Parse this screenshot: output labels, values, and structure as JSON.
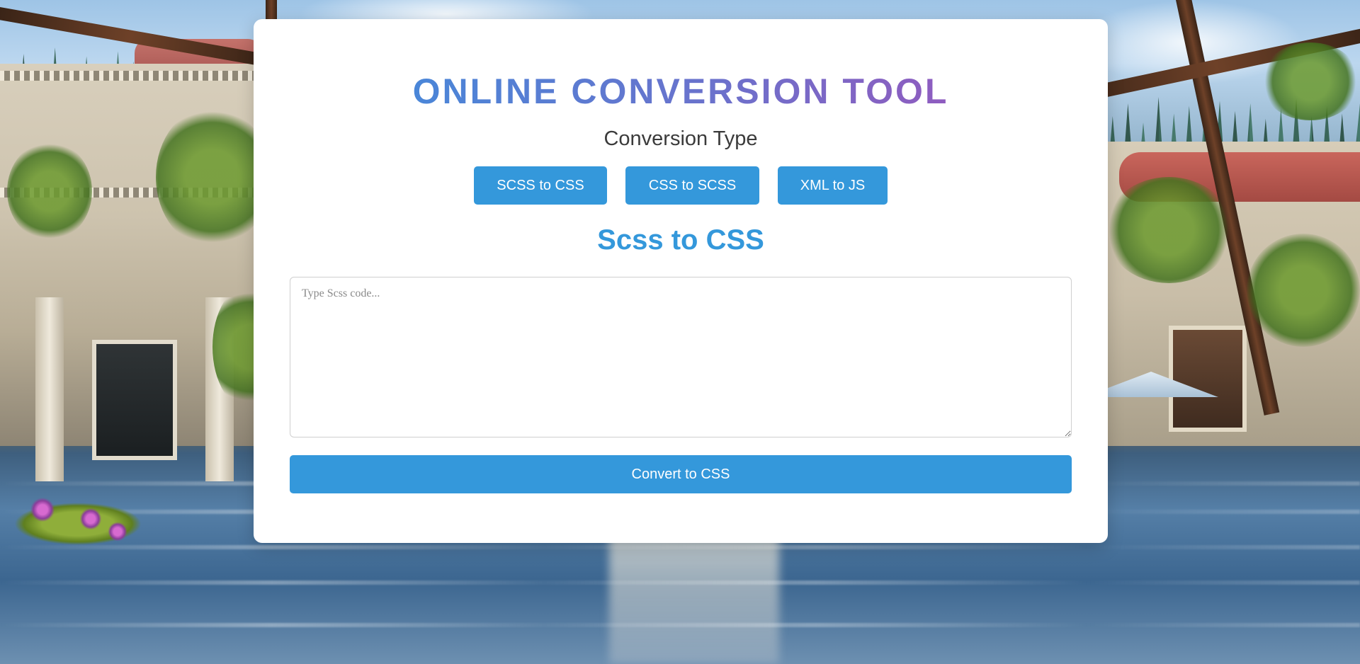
{
  "app": {
    "title": "ONLINE CONVERSION TOOL"
  },
  "conversion": {
    "section_label": "Conversion Type",
    "types": [
      {
        "label": "SCSS to CSS"
      },
      {
        "label": "CSS to SCSS"
      },
      {
        "label": "XML to JS"
      }
    ],
    "active_mode_heading": "Scss to CSS"
  },
  "editor": {
    "placeholder": "Type Scss code...",
    "value": ""
  },
  "actions": {
    "convert_label": "Convert to CSS"
  },
  "colors": {
    "accent": "#3498db",
    "title_gradient_start": "#4a86d8",
    "title_gradient_end": "#8f5cbf",
    "card_background": "#ffffff"
  }
}
